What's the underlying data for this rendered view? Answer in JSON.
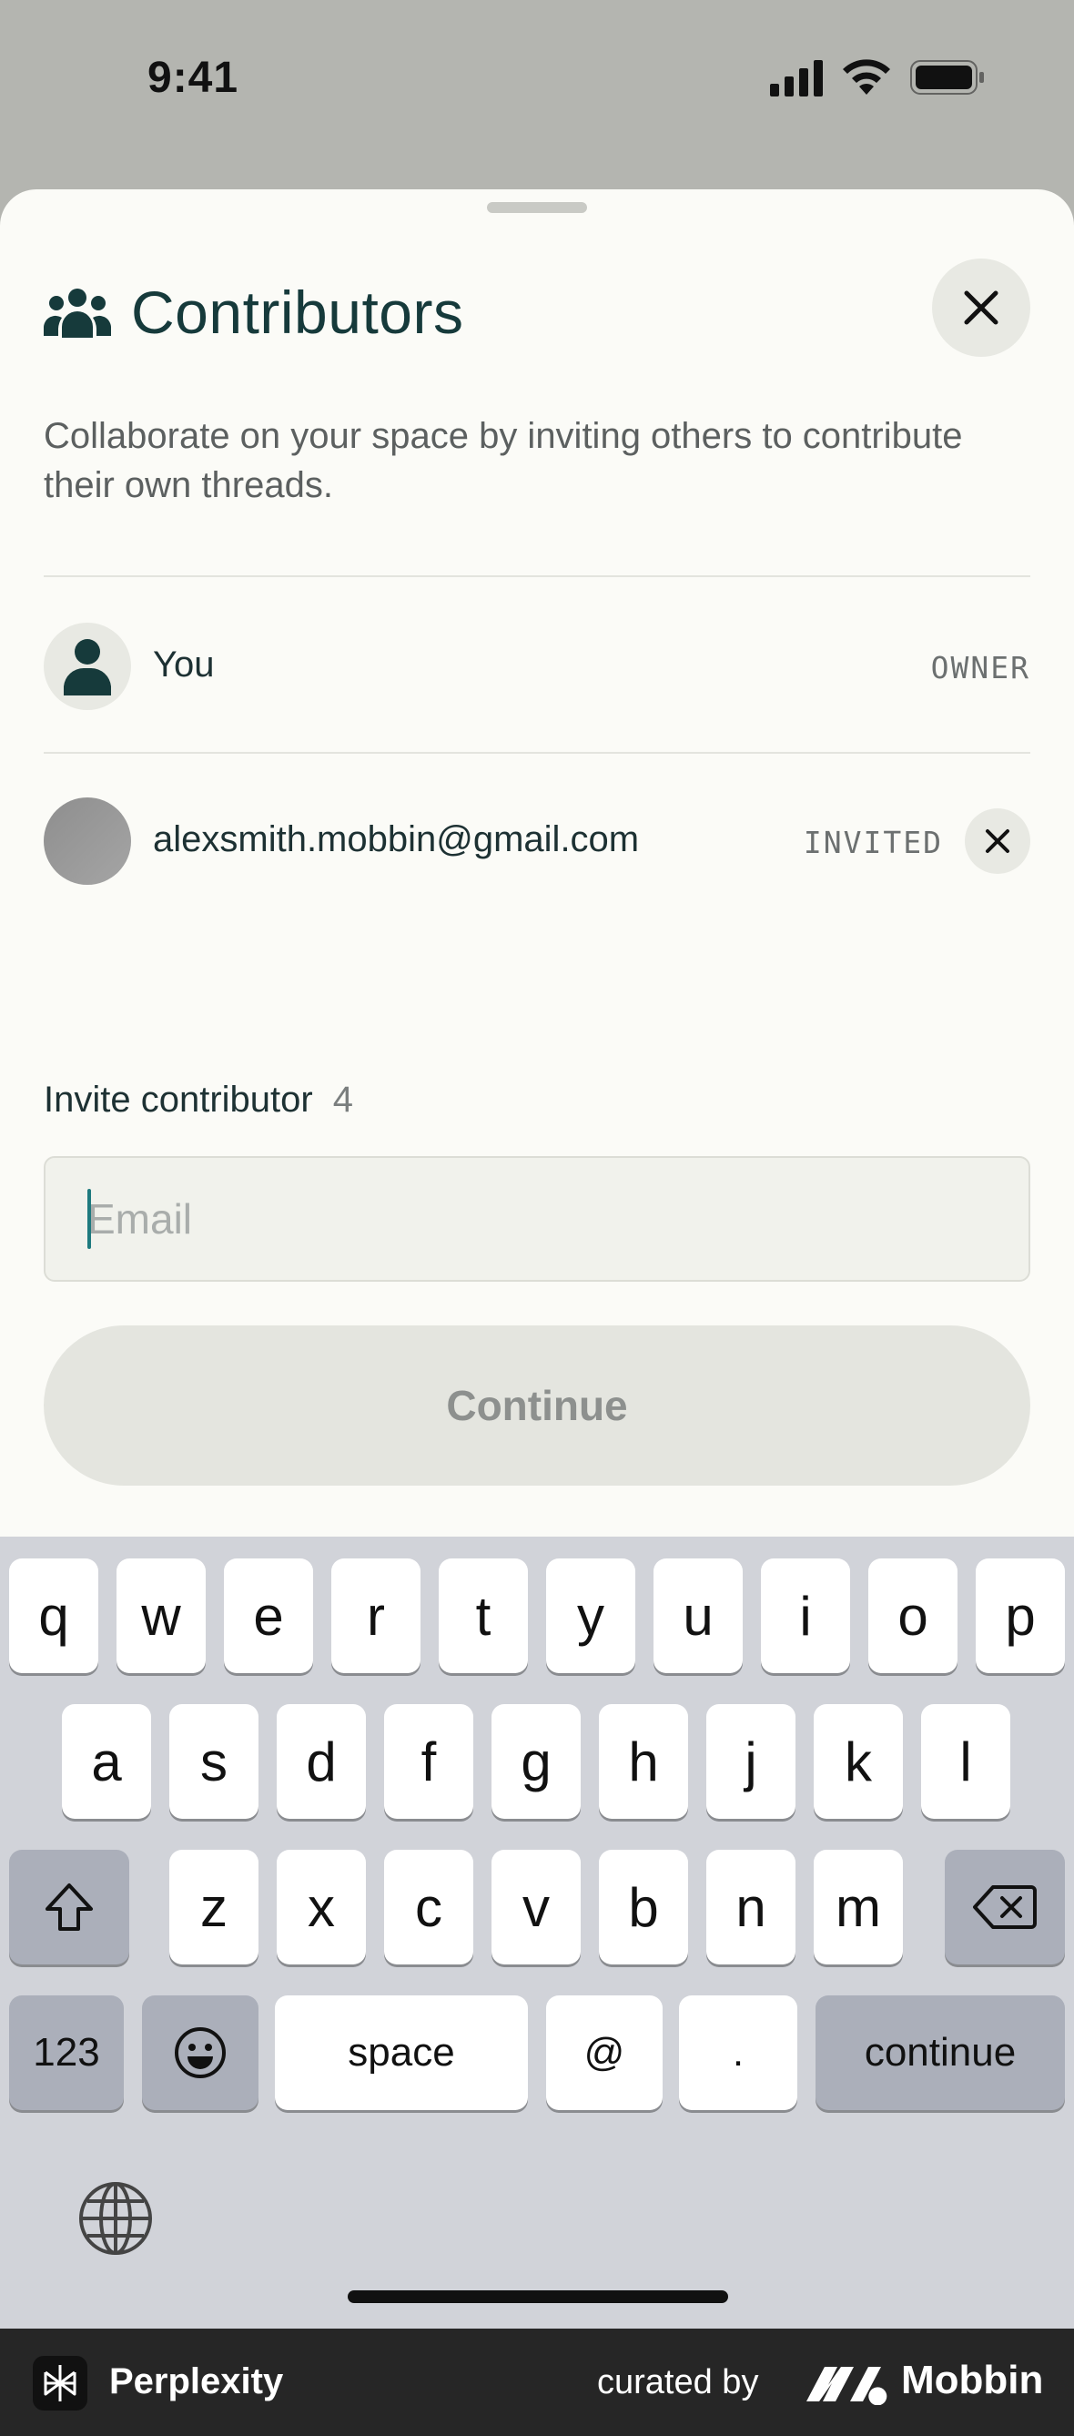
{
  "status_bar": {
    "time": "9:41"
  },
  "sheet": {
    "title": "Contributors",
    "description": "Collaborate on your space by inviting others to contribute their own threads.",
    "members": [
      {
        "name": "You",
        "role": "OWNER"
      },
      {
        "name": "alexsmith.mobbin@gmail.com",
        "role": "INVITED"
      }
    ],
    "invite": {
      "label": "Invite contributor",
      "count": "4",
      "email_placeholder": "Email",
      "email_value": "",
      "continue_label": "Continue"
    }
  },
  "keyboard": {
    "row1": [
      "q",
      "w",
      "e",
      "r",
      "t",
      "y",
      "u",
      "i",
      "o",
      "p"
    ],
    "row2": [
      "a",
      "s",
      "d",
      "f",
      "g",
      "h",
      "j",
      "k",
      "l"
    ],
    "row3": [
      "z",
      "x",
      "c",
      "v",
      "b",
      "n",
      "m"
    ],
    "numbers_key": "123",
    "space_key": "space",
    "at_key": "@",
    "dot_key": ".",
    "return_key": "continue"
  },
  "footer": {
    "app_name": "Perplexity",
    "curated_by": "curated by",
    "brand": "Mobbin"
  },
  "colors": {
    "accent": "#163a3b",
    "caret": "#1e7a7e",
    "sheet_bg": "#fbfbf7"
  }
}
